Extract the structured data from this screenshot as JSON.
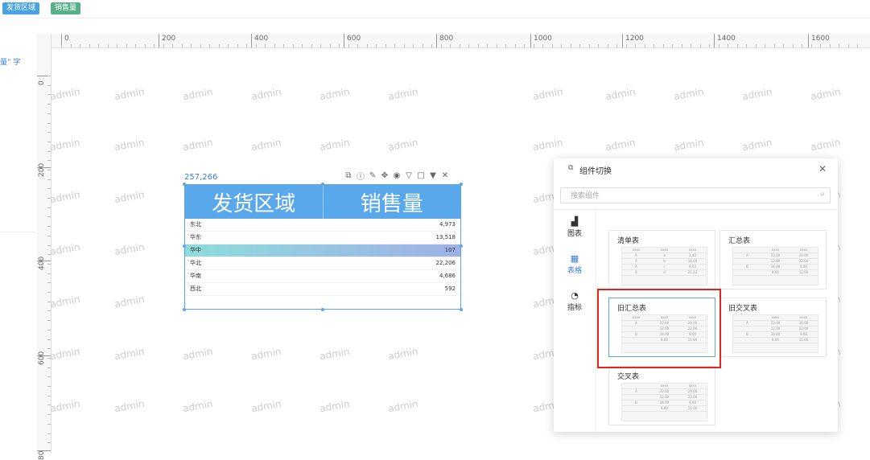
{
  "topbar": {
    "tags": [
      "发货区域",
      "销售量"
    ]
  },
  "left_fragment": "量” 字",
  "ruler": {
    "h_labels": [
      "0",
      "200",
      "400",
      "600",
      "800",
      "1000",
      "1200",
      "1400",
      "1600"
    ],
    "v_labels": [
      "0",
      "200",
      "400",
      "600",
      "80"
    ]
  },
  "watermark": "admin",
  "component": {
    "coord": "257,266",
    "headers": [
      "发货区域",
      "销售量"
    ],
    "rows": [
      {
        "region": "东北",
        "value": "4,973"
      },
      {
        "region": "华东",
        "value": "13,518"
      },
      {
        "region": "华中",
        "value": "107"
      },
      {
        "region": "华北",
        "value": "22,206"
      },
      {
        "region": "华南",
        "value": "4,686"
      },
      {
        "region": "西北",
        "value": "592"
      }
    ],
    "toolbar_icons": [
      "link-icon",
      "info-icon",
      "brush-icon",
      "move-icon",
      "eye-icon",
      "filter-icon",
      "box-icon",
      "caret-icon",
      "close-icon"
    ]
  },
  "dialog": {
    "title": "组件切换",
    "search_placeholder": "搜索组件",
    "tabs": [
      {
        "label": "图表"
      },
      {
        "label": "表格"
      },
      {
        "label": "指标"
      }
    ],
    "active_tab": "表格",
    "cards": [
      {
        "label": "清单表"
      },
      {
        "label": "汇总表"
      },
      {
        "label": "旧汇总表"
      },
      {
        "label": "旧交叉表"
      },
      {
        "label": "交叉表"
      }
    ],
    "selected_card": "旧汇总表",
    "highlight_color": "#e0261b"
  },
  "colors": {
    "accent": "#3a7bd5",
    "header": "#5aa8ec"
  }
}
